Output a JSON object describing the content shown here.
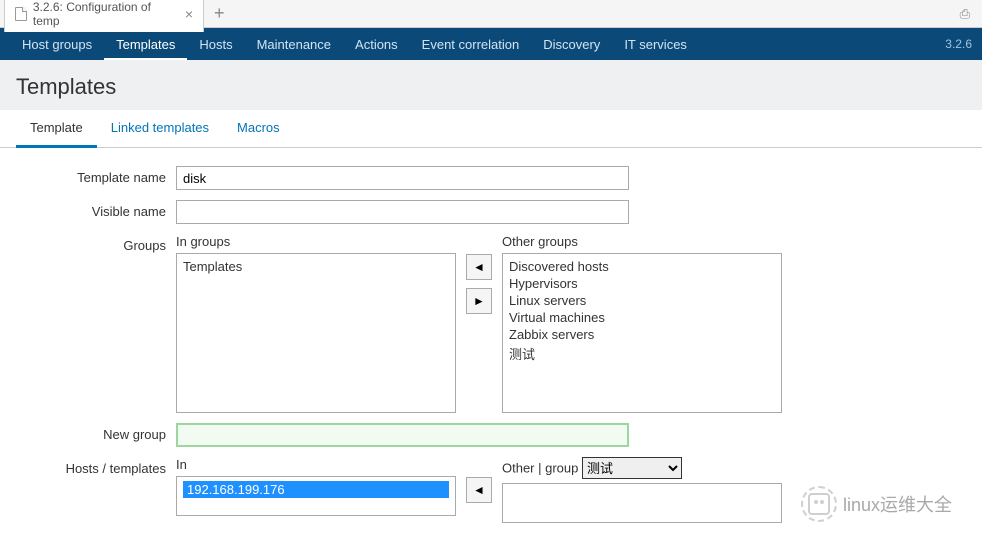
{
  "browser": {
    "tab_title": "3.2.6: Configuration of temp"
  },
  "nav": {
    "items": [
      "Host groups",
      "Templates",
      "Hosts",
      "Maintenance",
      "Actions",
      "Event correlation",
      "Discovery",
      "IT services"
    ],
    "active_index": 1,
    "version": "3.2.6"
  },
  "page": {
    "title": "Templates"
  },
  "subtabs": {
    "items": [
      "Template",
      "Linked templates",
      "Macros"
    ],
    "active_index": 0
  },
  "form": {
    "template_name": {
      "label": "Template name",
      "value": "disk"
    },
    "visible_name": {
      "label": "Visible name",
      "value": ""
    },
    "groups": {
      "label": "Groups",
      "in_label": "In groups",
      "other_label": "Other groups",
      "in_groups": [
        "Templates"
      ],
      "other_groups": [
        "Discovered hosts",
        "Hypervisors",
        "Linux servers",
        "Virtual machines",
        "Zabbix servers",
        "测试"
      ]
    },
    "new_group": {
      "label": "New group",
      "value": ""
    },
    "hosts": {
      "label": "Hosts / templates",
      "in_label": "In",
      "other_label": "Other | group",
      "group_select_value": "测试",
      "in_hosts": [
        "192.168.199.176"
      ],
      "in_hosts_selected": 0
    }
  },
  "watermark": {
    "text": "linux运维大全"
  },
  "arrows": {
    "left": "◄",
    "right": "►"
  }
}
